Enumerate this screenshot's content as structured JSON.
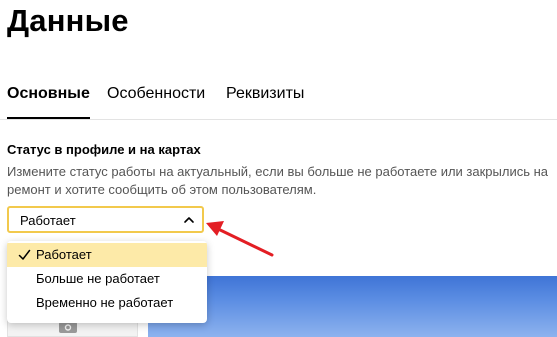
{
  "page": {
    "title": "Данные"
  },
  "tabs": [
    {
      "label": "Основные",
      "active": true
    },
    {
      "label": "Особенности",
      "active": false
    },
    {
      "label": "Реквизиты",
      "active": false
    }
  ],
  "status_section": {
    "label": "Статус в профиле и на картах",
    "description": "Измените статус работы на актуальный, если вы больше не работаете или закрылись на ремонт и хотите сообщить об этом пользователям.",
    "select": {
      "value": "Работает",
      "chevron_icon": "chevron-up-icon",
      "border_color": "#f2c94c"
    },
    "options": [
      {
        "label": "Работает",
        "selected": true
      },
      {
        "label": "Больше не работает",
        "selected": false
      },
      {
        "label": "Временно не работает",
        "selected": false
      }
    ]
  },
  "annotation": {
    "arrow_color": "#e31e24"
  },
  "colors": {
    "selected_option_bg": "#fdeaa8",
    "accent_yellow": "#f2c94c",
    "description_text": "#555555"
  }
}
